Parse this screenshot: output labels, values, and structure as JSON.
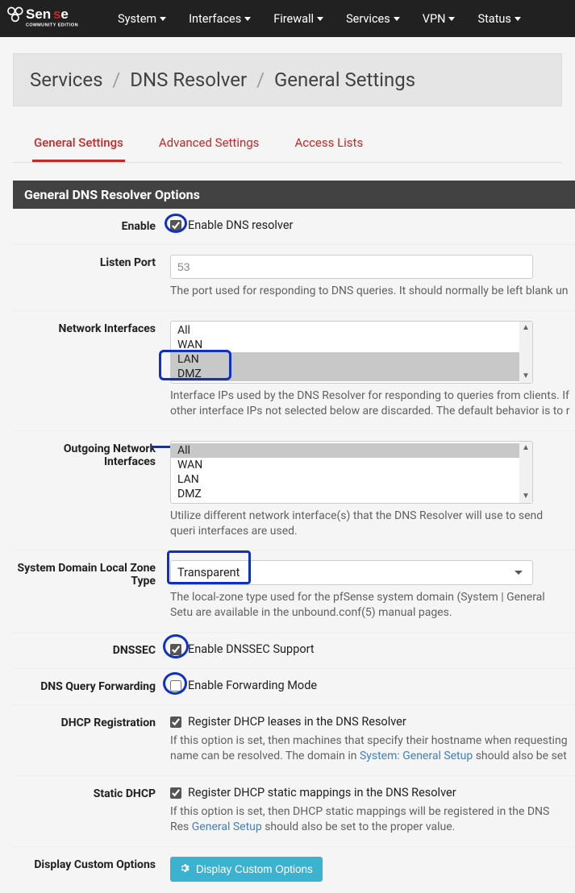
{
  "brand": {
    "name": "Sense",
    "edition": "COMMUNITY EDITION"
  },
  "nav": [
    {
      "label": "System"
    },
    {
      "label": "Interfaces"
    },
    {
      "label": "Firewall"
    },
    {
      "label": "Services"
    },
    {
      "label": "VPN"
    },
    {
      "label": "Status"
    }
  ],
  "breadcrumb": {
    "a": "Services",
    "b": "DNS Resolver",
    "c": "General Settings"
  },
  "tabs": [
    {
      "label": "General Settings",
      "active": true
    },
    {
      "label": "Advanced Settings",
      "active": false
    },
    {
      "label": "Access Lists",
      "active": false
    }
  ],
  "section_title": "General DNS Resolver Options",
  "fields": {
    "enable": {
      "label": "Enable",
      "text": "Enable DNS resolver",
      "checked": true
    },
    "listen_port": {
      "label": "Listen Port",
      "value": "53",
      "help": "The port used for responding to DNS queries. It should normally be left blank un"
    },
    "network_interfaces": {
      "label": "Network Interfaces",
      "options": [
        {
          "text": "All",
          "selected": false
        },
        {
          "text": "WAN",
          "selected": false
        },
        {
          "text": "LAN",
          "selected": true
        },
        {
          "text": "DMZ",
          "selected": true
        }
      ],
      "help": "Interface IPs used by the DNS Resolver for responding to queries from clients. If other interface IPs not selected below are discarded. The default behavior is to r"
    },
    "outgoing_interfaces": {
      "label": "Outgoing Network Interfaces",
      "options": [
        {
          "text": "All",
          "selected": true
        },
        {
          "text": "WAN",
          "selected": false
        },
        {
          "text": "LAN",
          "selected": false
        },
        {
          "text": "DMZ",
          "selected": false
        }
      ],
      "help": "Utilize different network interface(s) that the DNS Resolver will use to send queri interfaces are used."
    },
    "zone_type": {
      "label": "System Domain Local Zone Type",
      "value": "Transparent",
      "help_pre": "The local-zone type used for the pfSense system domain (System | General Setu are available in the unbound.conf(5) manual pages."
    },
    "dnssec": {
      "label": "DNSSEC",
      "text": "Enable DNSSEC Support",
      "checked": true
    },
    "forwarding": {
      "label": "DNS Query Forwarding",
      "text": "Enable Forwarding Mode",
      "checked": false
    },
    "dhcp_reg": {
      "label": "DHCP Registration",
      "text": "Register DHCP leases in the DNS Resolver",
      "checked": true,
      "help_a": "If this option is set, then machines that specify their hostname when requesting name can be resolved. The domain in ",
      "link": "System: General Setup",
      "help_b": " should also be set"
    },
    "static_dhcp": {
      "label": "Static DHCP",
      "text": "Register DHCP static mappings in the DNS Resolver",
      "checked": true,
      "help_a": "If this option is set, then DHCP static mappings will be registered in the DNS Res ",
      "link": "General Setup",
      "help_b": " should also be set to the proper value."
    },
    "custom": {
      "label": "Display Custom Options",
      "button": "Display Custom Options"
    }
  }
}
